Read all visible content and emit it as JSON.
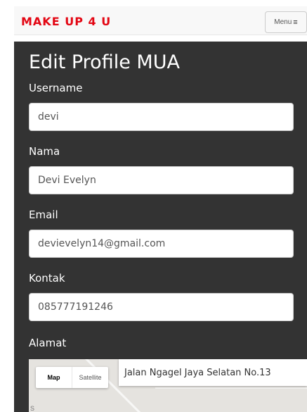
{
  "navbar": {
    "brand": "MAKE UP 4 U",
    "menu_label": "Menu",
    "brand_color": "#e30613"
  },
  "form": {
    "title": "Edit Profile MUA",
    "fields": [
      {
        "label": "Username",
        "value": "devi"
      },
      {
        "label": "Nama",
        "value": "Devi Evelyn"
      },
      {
        "label": "Email",
        "value": "devievelyn14@gmail.com"
      },
      {
        "label": "Kontak",
        "value": "085777191246"
      }
    ],
    "address_label": "Alamat"
  },
  "map": {
    "type_options": [
      "Map",
      "Satellite"
    ],
    "selected_type": "Map",
    "search_value": "Jalan Ngagel Jaya Selatan No.13",
    "corner_text": "S"
  },
  "colors": {
    "panel_bg": "#333333",
    "navbar_bg": "#f8f8f8"
  },
  "icons": {
    "menu": "hamburger-icon"
  }
}
